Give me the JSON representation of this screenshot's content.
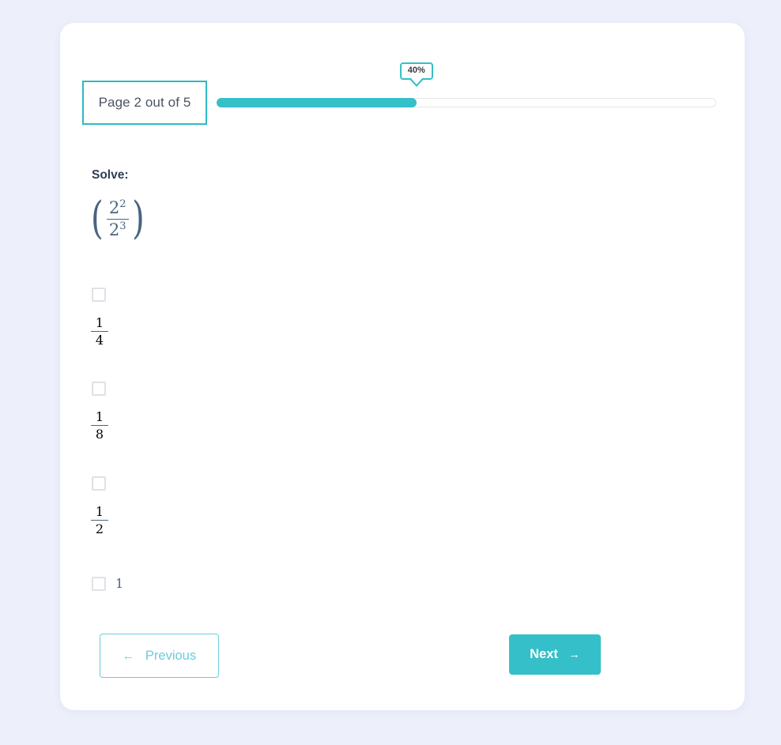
{
  "page": {
    "background_color": "#edf0fb",
    "card_background": "#ffffff",
    "accent_color": "#35bfc8"
  },
  "progress": {
    "page_indicator_label": "Page 2 out of 5",
    "current_page": 2,
    "total_pages": 5,
    "percent_label": "40%",
    "percent_value": 40,
    "fill_color": "#35bfc8",
    "track_color": "#e6e6e6"
  },
  "question": {
    "prompt": "Solve:",
    "expression_plain": "(2^2 / 2^3)",
    "expression": {
      "left_paren": "(",
      "right_paren": ")",
      "numerator_base": "2",
      "numerator_exponent": "2",
      "denominator_base": "2",
      "denominator_exponent": "3"
    }
  },
  "options": [
    {
      "id": "option-1",
      "layout": "stacked",
      "value_plain": "1/4",
      "numerator": "1",
      "denominator": "4",
      "checked": false
    },
    {
      "id": "option-2",
      "layout": "stacked",
      "value_plain": "1/8",
      "numerator": "1",
      "denominator": "8",
      "checked": false
    },
    {
      "id": "option-3",
      "layout": "stacked",
      "value_plain": "1/2",
      "numerator": "1",
      "denominator": "2",
      "checked": false
    },
    {
      "id": "option-4",
      "layout": "inline",
      "value_plain": "1",
      "text": "1",
      "checked": false
    }
  ],
  "footer": {
    "previous_label": "Previous",
    "previous_arrow": "←",
    "next_label": "Next",
    "next_arrow": "→"
  }
}
